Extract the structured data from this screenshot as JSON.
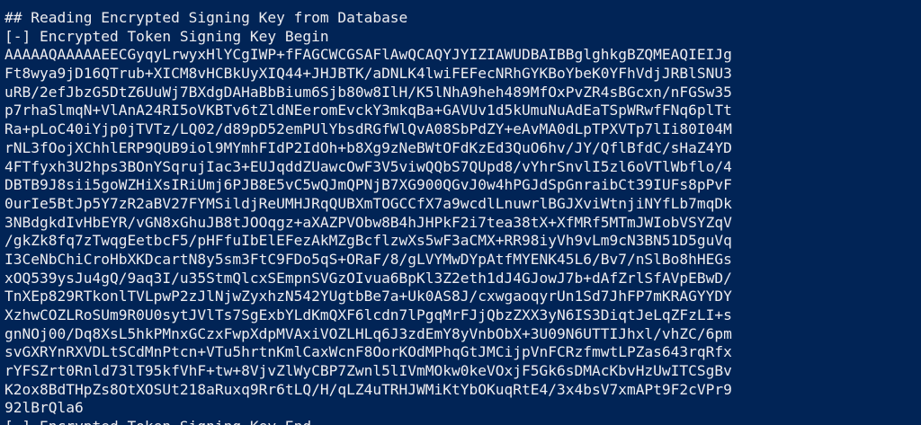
{
  "console": {
    "background": "#012456",
    "text_color": "#eeedf0",
    "lines": [
      "## Reading Encrypted Signing Key from Database",
      "[-] Encrypted Token Signing Key Begin",
      "AAAAAQAAAAAEECGyqyLrwyxHlYCgIWP+fFAGCWCGSAFlAwQCAQYJYIZIAWUDBAIBBglghkgBZQMEAQIEIJg",
      "Ft8wya9jD16QTrub+XICM8vHCBkUyXIQ44+JHJBTK/aDNLK4lwiFEFecNRhGYKBoYbeK0YFhVdjJRBlSNU3",
      "uRB/2efJbzG5DtZ6UuWj7BXdgDAHaBbBium6Sjb80w8IlH/K5lNhA9heh489MfOxPvZR4sBGcxn/nFGSw35",
      "p7rhaSlmqN+VlAnA24RI5oVKBTv6tZldNEeromEvckY3mkqBa+GAVUv1d5kUmuNuAdEaTSpWRwfFNq6plTt",
      "Ra+pLoC40iYjp0jTVTz/LQ02/d89pD52emPUlYbsdRGfWlQvA08SbPdZY+eAvMA0dLpTPXVTp7lIi80I04M",
      "rNL3fOojXChhlERP9QUB9iol9MYmhFIdP2IdOh+b8Xg9zNeBWtOFdKzEd3QuO6hv/JY/QflBfdC/sHaZ4YD",
      "4FTfyxh3U2hps3BOnYSqrujIac3+EUJqddZUawcOwF3V5viwQQbS7QUpd8/vYhrSnvlI5zl6oVTlWbflo/4",
      "DBTB9J8sii5goWZHiXsIRiUmj6PJB8E5vC5wQJmQPNjB7XG900QGvJ0w4hPGJdSpGnraibCt39IUFs8pPvF",
      "0urIe5BtJp5Y7zR2aBV27FYMSildjReUMHJRqQUBXmTOGCCfX7a9wcdlLnuwrlBGJXviWtnjiNYfLb7mqDk",
      "3NBdgkdIvHbEYR/vGN8xGhuJB8tJOOqgz+aXAZPVObw8B4hJHPkF2i7tea38tX+XfMRf5MTmJWIobVSYZqV",
      "/gkZk8fq7zTwqgEetbcF5/pHFfuIbElEFezAkMZgBcflzwXs5wF3aCMX+RR98iyVh9vLm9cN3BN51D5guVq",
      "I3CeNbChiCroHbXKDcartN8y5sm3FtC9FDo5qS+ORaF/8/gLVYMwDYpAtfMYENK45L6/Bv7/nSlBo8hHEGs",
      "xOQ539ysJu4gQ/9aq3I/u35StmQlcxSEmpnSVGzOIvua6BpKl3Z2eth1dJ4GJowJ7b+dAfZrlSfAVpEBwD/",
      "TnXEp829RTkonlTVLpwP2zJlNjwZyxhzN542YUgtbBe7a+Uk0AS8J/cxwgaoqyrUn1Sd7JhFP7mKRAGYYDY",
      "XzhwCOZLRoSUm9R0U0sytJVlTs7SgExbYLdKmQXF6lcdn7lPgqMrFJjQbzZXX3yN6IS3DiqtJeLqZFzLI+s",
      "gnNOj00/Dq8XsL5hkPMnxGCzxFwpXdpMVAxiVOZLHLq6J3zdEmY8yVnbObX+3U09N6UTTIJhxl/vhZC/6pm",
      "svGXRYnRXVDLtSCdMnPtcn+VTu5hrtnKmlCaxWcnF8OorKOdMPhqGtJMCijpVnFCRzfmwtLPZas643rqRfx",
      "rYFSZrt0Rnld73lT95kfVhF+tw+8VjvZlWyCBP7Zwnl5lIVmMOkw0keVOxjF5Gk6sDMAcKbvHzUwITCSgBv",
      "K2ox8BdTHpZs8OtXOSUt218aRuxq9Rr6tLQ/H/qLZ4uTRHJWMiKtYbOKuqRtE4/3x4bsV7xmAPt9F2cVPr9",
      "92lBrQla6",
      "[-] Encrypted Token Signing Key End"
    ]
  }
}
